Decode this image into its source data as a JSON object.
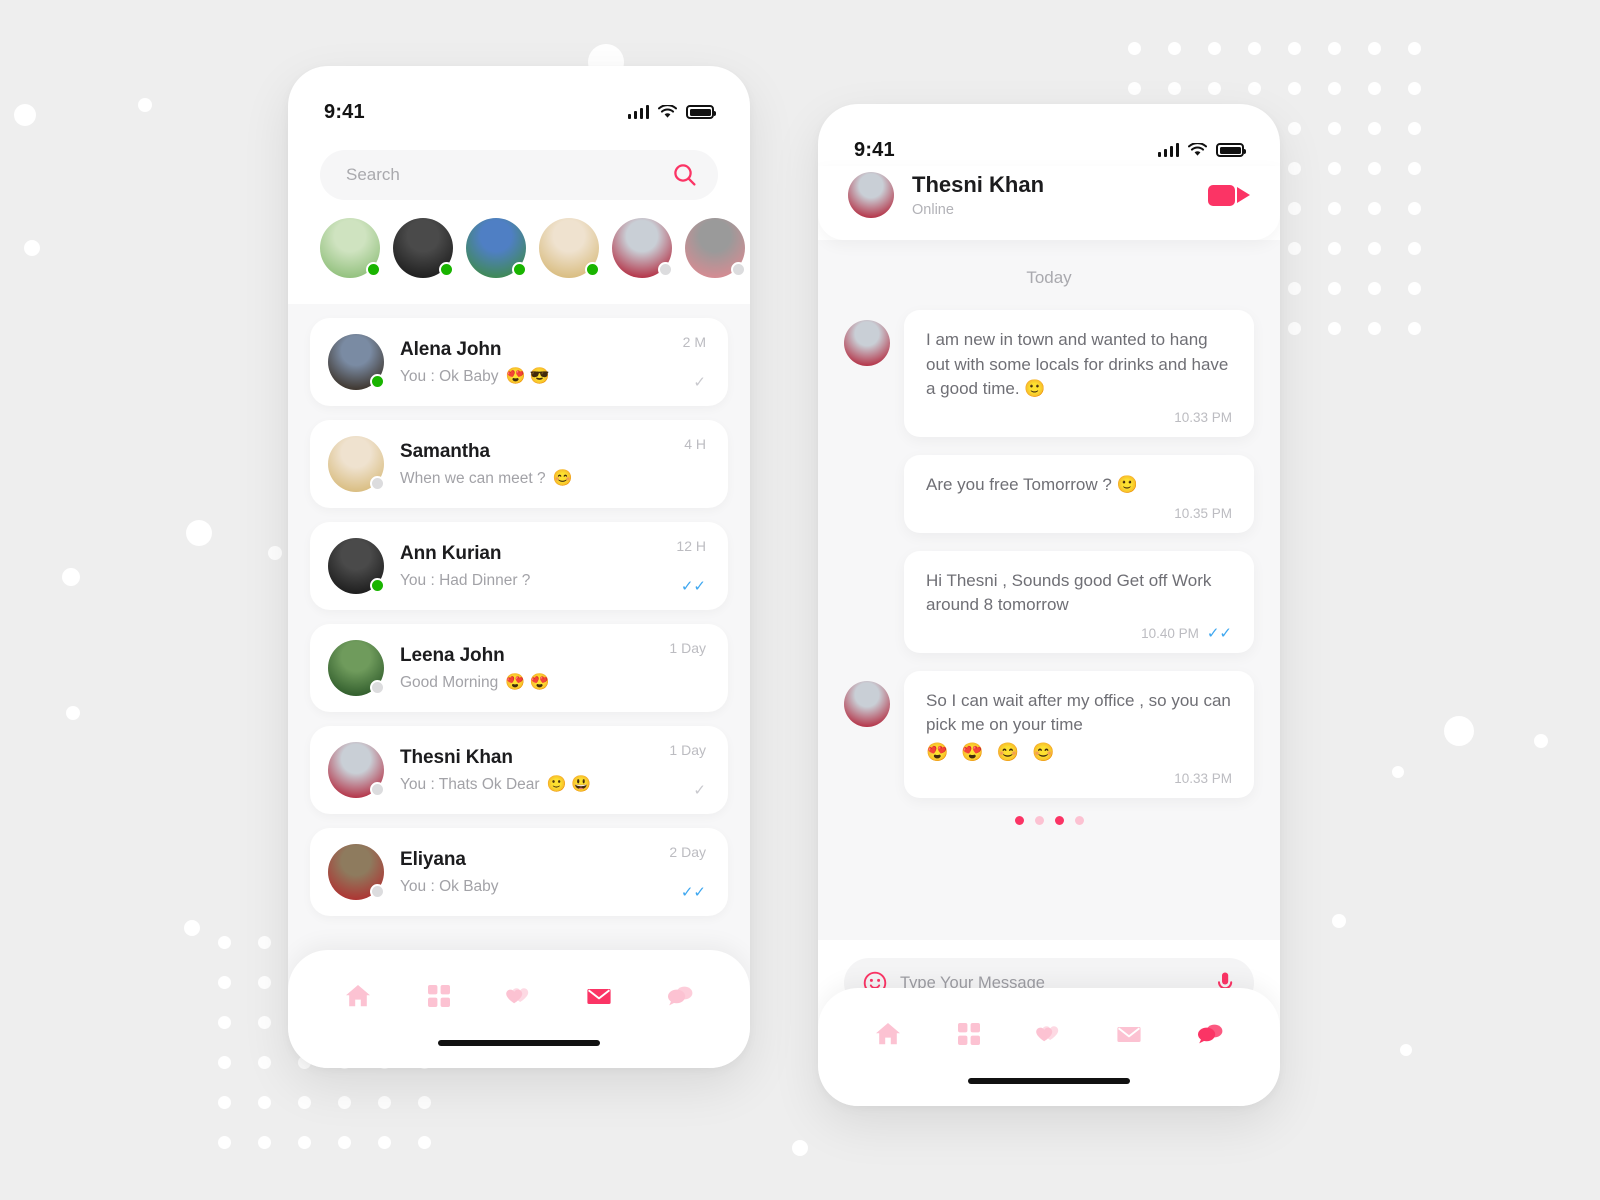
{
  "theme": {
    "accent": "#fb3465",
    "accent_soft": "#fcc2d2",
    "online": "#19b400",
    "offline": "#dcdcde",
    "page_bg": "#eeeeee",
    "panel_bg": "#f7f7f8",
    "read_blue": "#3ea7f0"
  },
  "status_bar": {
    "time": "9:41",
    "signal_icon": "cellular-signal-icon",
    "wifi_icon": "wifi-icon",
    "battery_icon": "battery-icon"
  },
  "left_screen": {
    "search": {
      "placeholder": "Search",
      "value": "",
      "icon": "search-icon"
    },
    "stories": [
      {
        "name": "story-1",
        "online": true,
        "c1": "#cfe3c0",
        "c2": "#8fbf7a"
      },
      {
        "name": "story-2",
        "online": true,
        "c1": "#4a4a4a",
        "c2": "#1d1d1d"
      },
      {
        "name": "story-3",
        "online": true,
        "c1": "#4f7fc4",
        "c2": "#3f8a4e"
      },
      {
        "name": "story-4",
        "online": true,
        "c1": "#efe2cf",
        "c2": "#d8bb7c"
      },
      {
        "name": "story-5",
        "online": false,
        "c1": "#c9cfd6",
        "c2": "#b32a3f"
      },
      {
        "name": "story-6",
        "online": false,
        "c1": "#9a9a9a",
        "c2": "#d98b92"
      }
    ],
    "chats": [
      {
        "name": "Alena John",
        "preview": "You : Ok Baby",
        "emojis": "😍 😎",
        "time": "2 M",
        "online": true,
        "tick": "✓",
        "tick_state": "gray",
        "c1": "#7a8ba3",
        "c2": "#3a3026"
      },
      {
        "name": "Samantha",
        "preview": "When we can meet ?",
        "emojis": "😊",
        "time": "4 H",
        "online": false,
        "tick": "",
        "tick_state": "none",
        "c1": "#efe2cf",
        "c2": "#d8bb7c"
      },
      {
        "name": "Ann Kurian",
        "preview": "You : Had Dinner ?",
        "emojis": "",
        "time": "12 H",
        "online": true,
        "tick": "✓✓",
        "tick_state": "blue",
        "c1": "#4a4a4a",
        "c2": "#1b1b1b"
      },
      {
        "name": "Leena John",
        "preview": "Good Morning",
        "emojis": "😍 😍",
        "time": "1 Day",
        "online": false,
        "tick": "",
        "tick_state": "none",
        "c1": "#6f9b5c",
        "c2": "#2e5a2a"
      },
      {
        "name": "Thesni Khan",
        "preview": "You : Thats Ok Dear",
        "emojis": "🙂 😃",
        "time": "1 Day",
        "online": false,
        "tick": "✓",
        "tick_state": "gray",
        "c1": "#c9cfd6",
        "c2": "#b32a3f"
      },
      {
        "name": "Eliyana",
        "preview": "You : Ok Baby",
        "emojis": "",
        "time": "2 Day",
        "online": false,
        "tick": "✓✓",
        "tick_state": "blue",
        "c1": "#8e7b5e",
        "c2": "#b03030"
      }
    ],
    "tabbar": [
      {
        "icon": "home-icon",
        "label": "Home",
        "active": false
      },
      {
        "icon": "grid-icon",
        "label": "Discover",
        "active": false
      },
      {
        "icon": "hearts-icon",
        "label": "Matches",
        "active": false
      },
      {
        "icon": "envelope-icon",
        "label": "Mail",
        "active": true
      },
      {
        "icon": "chat-bubbles-icon",
        "label": "Chats",
        "active": false
      }
    ]
  },
  "right_screen": {
    "header": {
      "name": "Thesni Khan",
      "status": "Online",
      "call_icon": "video-camera-icon"
    },
    "day_label": "Today",
    "messages": [
      {
        "side": "in",
        "show_avatar": true,
        "text": "I am new in town and wanted to hang out with some locals for drinks and have a good time. 🙂",
        "emojis": "",
        "time": "10.33 PM",
        "tick": "",
        "tick_state": "none"
      },
      {
        "side": "in",
        "show_avatar": false,
        "text": "Are you free Tomorrow ? 🙂",
        "emojis": "",
        "time": "10.35 PM",
        "tick": "",
        "tick_state": "none"
      },
      {
        "side": "out",
        "show_avatar": false,
        "text": "Hi Thesni , Sounds good Get off Work around 8 tomorrow",
        "emojis": "",
        "time": "10.40 PM",
        "tick": "✓✓",
        "tick_state": "blue"
      },
      {
        "side": "in",
        "show_avatar": true,
        "text": "So I can wait after my office , so you can pick me on your time",
        "emojis": "😍 😍 😊 😊",
        "time": "10.33 PM",
        "tick": "",
        "tick_state": "none"
      }
    ],
    "pager": [
      {
        "active": true
      },
      {
        "active": false
      },
      {
        "active": true
      },
      {
        "active": false
      }
    ],
    "composer": {
      "placeholder": "Type Your Message",
      "value": "",
      "emoji_icon": "smiley-face-icon",
      "mic_icon": "microphone-icon"
    },
    "tabbar": [
      {
        "icon": "home-icon",
        "label": "Home",
        "active": false
      },
      {
        "icon": "grid-icon",
        "label": "Discover",
        "active": false
      },
      {
        "icon": "hearts-icon",
        "label": "Matches",
        "active": false
      },
      {
        "icon": "envelope-icon",
        "label": "Mail",
        "active": false
      },
      {
        "icon": "chat-bubbles-icon",
        "label": "Chats",
        "active": true
      }
    ]
  }
}
